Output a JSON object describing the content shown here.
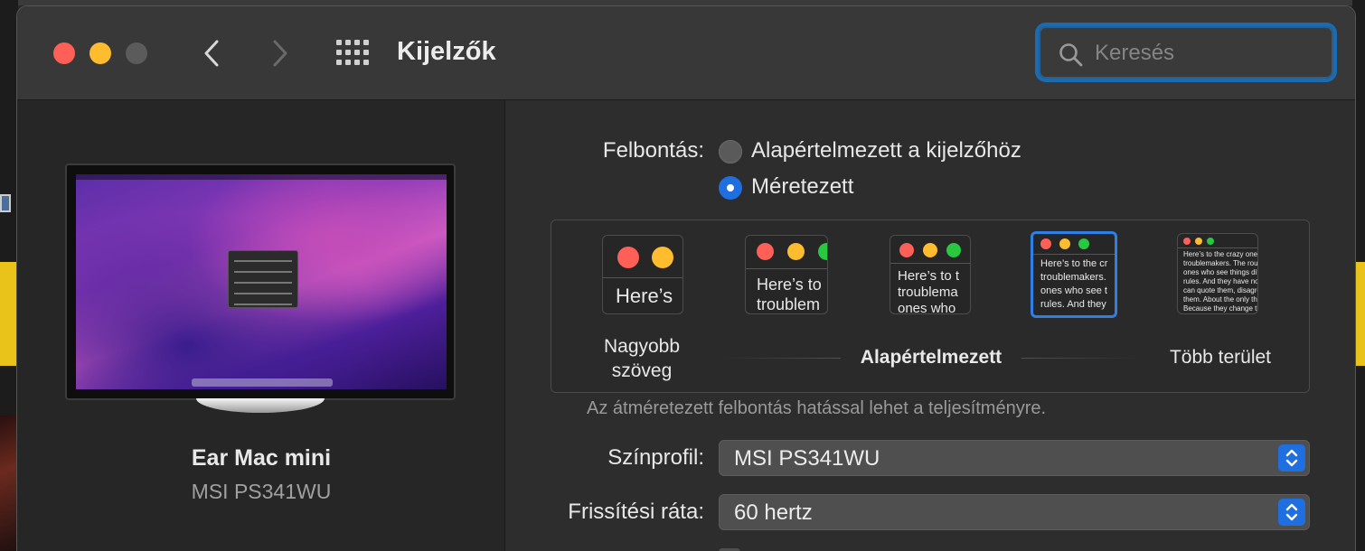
{
  "window": {
    "title": "Kijelzők"
  },
  "search": {
    "placeholder": "Keresés"
  },
  "sidebar": {
    "device_name": "Ear Mac mini",
    "device_model": "MSI PS341WU"
  },
  "resolution": {
    "label": "Felbontás:",
    "options": [
      {
        "label": "Alapértelmezett a kijelzőhöz",
        "selected": false
      },
      {
        "label": "Méretezett",
        "selected": true
      }
    ],
    "scale_labels": {
      "larger": "Nagyobb szöveg",
      "default": "Alapértelmezett",
      "more": "Több terület"
    },
    "thumbnails": [
      {
        "lines": [
          "Here’s"
        ]
      },
      {
        "lines": [
          "Here’s to",
          "troublem"
        ]
      },
      {
        "lines": [
          "Here’s to t",
          "troublema",
          "ones who"
        ]
      },
      {
        "lines": [
          "Here’s to the cr",
          "troublemakers.",
          "ones who see t",
          "rules. And they"
        ]
      },
      {
        "lines": [
          "Here’s to the crazy ones",
          "troublemakers. The rou",
          "ones who see things dif",
          "rules. And they have no",
          "can quote them, disagre",
          "them. About the only th",
          "Because they change th"
        ]
      }
    ],
    "selected_index": 3,
    "note": "Az átméretezett felbontás hatással lehet a teljesítményre."
  },
  "color_profile": {
    "label": "Színprofil:",
    "value": "MSI PS341WU"
  },
  "refresh_rate": {
    "label": "Frissítési ráta:",
    "value": "60 hertz"
  },
  "colors": {
    "accent": "#1f6fe0",
    "close": "#fe5f57",
    "minimize": "#febc2e",
    "zoom_disabled": "#5b5b5b",
    "thumb_green": "#28c840"
  }
}
